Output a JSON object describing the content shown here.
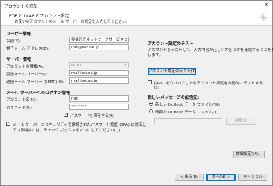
{
  "window": {
    "title": "アカウントの追加"
  },
  "header": {
    "title": "POP と IMAP のアカウント設定",
    "subtitle": "お使いのアカウントのメール サーバーの設定を入力してください。"
  },
  "user_info": {
    "section": "ユーザー情報",
    "name_label": "名前(Y):",
    "name_value": "奥能町光ネットワークサービスセンタ",
    "email_label": "電子メール アドレス(E):",
    "email_value": "info@iwk.ne.jp"
  },
  "server_info": {
    "section": "サーバー情報",
    "account_type_label": "アカウントの種類(A):",
    "account_type_value": "POP3",
    "incoming_label": "受信メール サーバー(I):",
    "incoming_value": "mail.iwk.ne.jp",
    "outgoing_label": "送信メール サーバー (SMTP)(O):",
    "outgoing_value": "mail.iwk.ne.jp"
  },
  "login_info": {
    "section": "メール サーバーへのログオン情報",
    "account_label": "アカウント名(U):",
    "account_value": "info",
    "password_label": "パスワード(P):",
    "password_value": "********",
    "remember_label": "パスワードを保存する(R)",
    "spa_line1": "メール サーバーがセキュリティで保護されたパスワード認証 (SPA) に対応し",
    "spa_line2": "ている場合には、チェック ボックスをオンにしてください(Q)"
  },
  "test": {
    "section": "アカウント設定のテスト",
    "desc1": "アカウントをテストして、入力内容が正しいかどうかを確認することをお勧め",
    "desc2": "します。",
    "button": "アカウント設定のテスト(T)",
    "auto_line1": "[次へ] をクリックしたらアカウント設定を自動的にテストする",
    "auto_line2": "(S)"
  },
  "delivery": {
    "section": "新しいメッセージの配信先:",
    "new_file": "新しい Outlook データ ファイル(W)",
    "existing_file": "既存の Outlook データ ファイル(X)",
    "browse": "参照(S)"
  },
  "buttons": {
    "more_settings": "詳細設定(M)...",
    "back": "< 戻る(B)",
    "next": "次へ(N) >",
    "cancel": "キャンセル"
  },
  "icons": {
    "close": "close-icon",
    "header": "sparkle-icon"
  }
}
